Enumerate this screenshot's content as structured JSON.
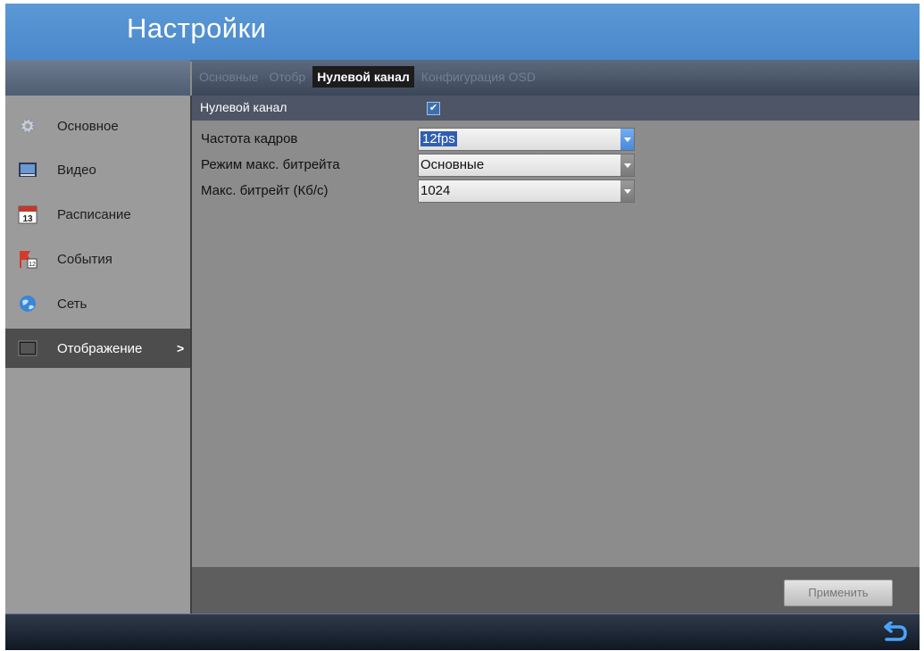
{
  "window": {
    "title": "Настройки"
  },
  "sidebar": {
    "items": [
      {
        "label": "Основное",
        "icon": "gear-icon"
      },
      {
        "label": "Видео",
        "icon": "video-icon"
      },
      {
        "label": "Расписание",
        "icon": "calendar-icon",
        "icon_text": "13"
      },
      {
        "label": "События",
        "icon": "events-icon",
        "icon_text": "12"
      },
      {
        "label": "Сеть",
        "icon": "network-globe-icon"
      },
      {
        "label": "Отображение",
        "icon": "display-icon",
        "active": true,
        "arrow": ">"
      }
    ]
  },
  "tabs": [
    {
      "label": "Основные"
    },
    {
      "label": "Отобр"
    },
    {
      "label": "Нулевой канал",
      "active": true
    },
    {
      "label": "Конфигурация OSD"
    }
  ],
  "form": {
    "zero_channel": {
      "label": "Нулевой канал",
      "checked": true,
      "check_glyph": "✔"
    },
    "frame_rate": {
      "label": "Частота кадров",
      "value": "12fps"
    },
    "bitrate_mode": {
      "label": "Режим макс. битрейта",
      "value": "Основные"
    },
    "max_bitrate": {
      "label": "Макс. битрейт (Кб/с)",
      "value": "1024"
    }
  },
  "actions": {
    "apply_label": "Применить"
  },
  "status": {
    "back_icon": "back-arrow-icon"
  },
  "colors": {
    "title_bar": "#4a88cb",
    "tab_active": "#1c1c1c",
    "selection": "#2f5fb3"
  }
}
